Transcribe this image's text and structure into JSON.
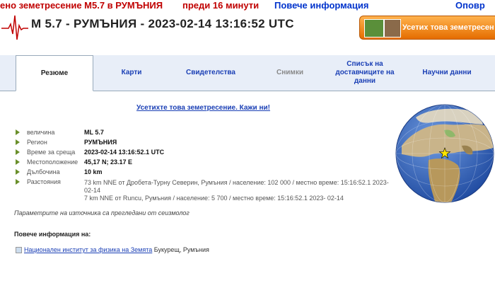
{
  "ticker": {
    "item1": "ено земетресение M5.7 в РУМЪНИЯ",
    "item2": "преди 16 минути",
    "item3": "Повече информация",
    "item4": "Оповр"
  },
  "header": {
    "title": "M 5.7 - РУМЪНИЯ - 2023-02-14 13:16:52 UTC",
    "felt_button": "Усетих това земетресен"
  },
  "tabs": [
    {
      "label": "Резюме",
      "state": "active"
    },
    {
      "label": "Карти",
      "state": "link"
    },
    {
      "label": "Свидетелства",
      "state": "link"
    },
    {
      "label": "Снимки",
      "state": "disabled"
    },
    {
      "label": "Списък на доставчиците на данни",
      "state": "link"
    },
    {
      "label": "Научни данни",
      "state": "link"
    }
  ],
  "felt_link": "Усетихте това земетресение. Кажи ни!",
  "details": [
    {
      "label": "величина",
      "value": "ML 5.7",
      "bold": true
    },
    {
      "label": "Регион",
      "value": "РУМЪНИЯ",
      "bold": true
    },
    {
      "label": "Време за среща",
      "value": "2023-02-14 13:16:52.1 UTC",
      "bold": true
    },
    {
      "label": "Местоположение",
      "value": "45,17 N; 23.17 E",
      "bold": true
    },
    {
      "label": "Дълбочина",
      "value": "10 km",
      "bold": true
    },
    {
      "label": "Разстояния",
      "value": "",
      "bold": false
    }
  ],
  "distances": [
    "73 km NNE от Дробета-Турну Северин, Румъния / население: 102 000 / местно време: 15:16:52.1 2023-02-14",
    "7 km NNE от Runcu, Румъния / население: 5 700 / местно време: 15:16:52.1 2023- 02-14"
  ],
  "note": "Параметрите на източника са прегледани от сеизмолог",
  "more_info_heading": "Повече информация на:",
  "institution": {
    "name": "Национален институт за физика на Земята",
    "city": "Букурещ, Румъния"
  },
  "colors": {
    "ticker_red": "#c00000",
    "ticker_blue": "#0033cc",
    "link_blue": "#1a3fb5",
    "tab_bar_bg": "#e8eef8",
    "felt_button": "#f08a1a",
    "bullet_green": "#6a8f2a",
    "globe_ocean": "#2f5fb8"
  },
  "icons": [
    "seismograph-icon",
    "arrow-bullet-icon",
    "globe-icon",
    "epicenter-star-icon",
    "link-icon"
  ]
}
